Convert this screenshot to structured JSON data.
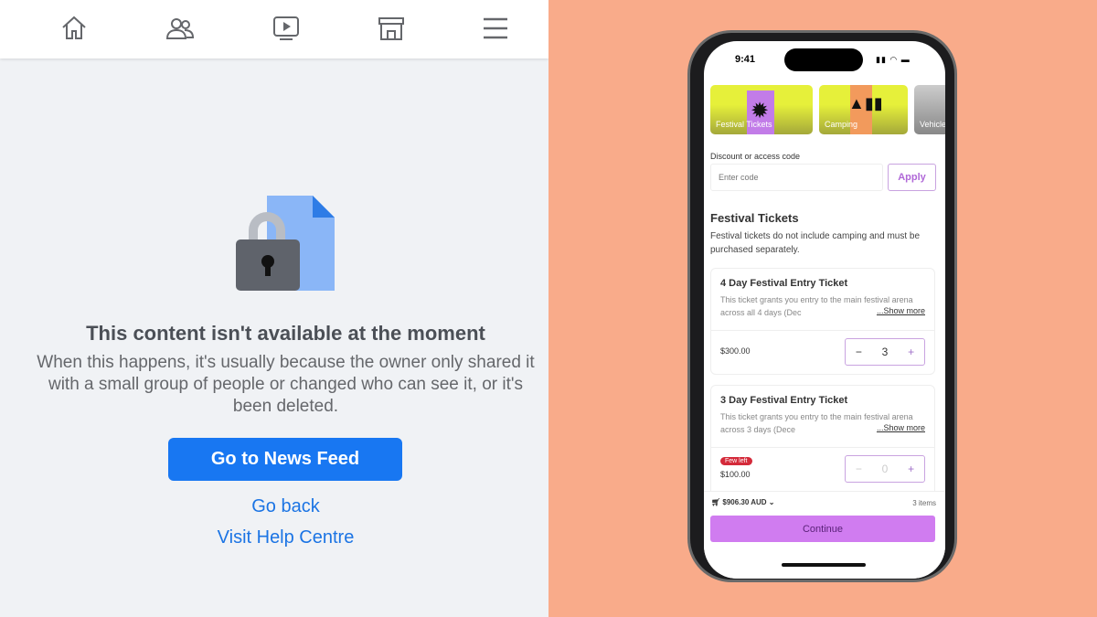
{
  "left": {
    "nav": [
      "home-icon",
      "friends-icon",
      "watch-icon",
      "marketplace-icon",
      "menu-icon"
    ],
    "title": "This content isn't available at the moment",
    "body": "When this happens, it's usually because the owner only shared it with a small group of people or changed who can see it, or it's been deleted.",
    "primary_button": "Go to News Feed",
    "go_back": "Go back",
    "help": "Visit Help Centre"
  },
  "phone": {
    "time": "9:41",
    "categories": [
      "Festival Tickets",
      "Camping",
      "Vehicle"
    ],
    "discount_label": "Discount or access code",
    "code_placeholder": "Enter code",
    "apply": "Apply",
    "section_title": "Festival Tickets",
    "section_desc": "Festival tickets do not include camping and must be purchased separately.",
    "tickets": [
      {
        "name": "4 Day Festival Entry Ticket",
        "desc": "This ticket grants you entry to the main festival arena across all 4 days (Dec",
        "show_more": "...Show more",
        "price": "$300.00",
        "qty": "3"
      },
      {
        "name": "3 Day Festival Entry Ticket",
        "desc": "This ticket grants you entry to the main festival arena across 3 days (Dece",
        "show_more": "...Show more",
        "price": "$100.00",
        "qty": "0",
        "badge": "Few left"
      }
    ],
    "total": "$906.30 AUD",
    "items": "3 items",
    "continue": "Continue"
  },
  "colors": {
    "accent_fb": "#1877f2",
    "accent_phone": "#d07cf0",
    "background_right": "#f9ab8a"
  }
}
